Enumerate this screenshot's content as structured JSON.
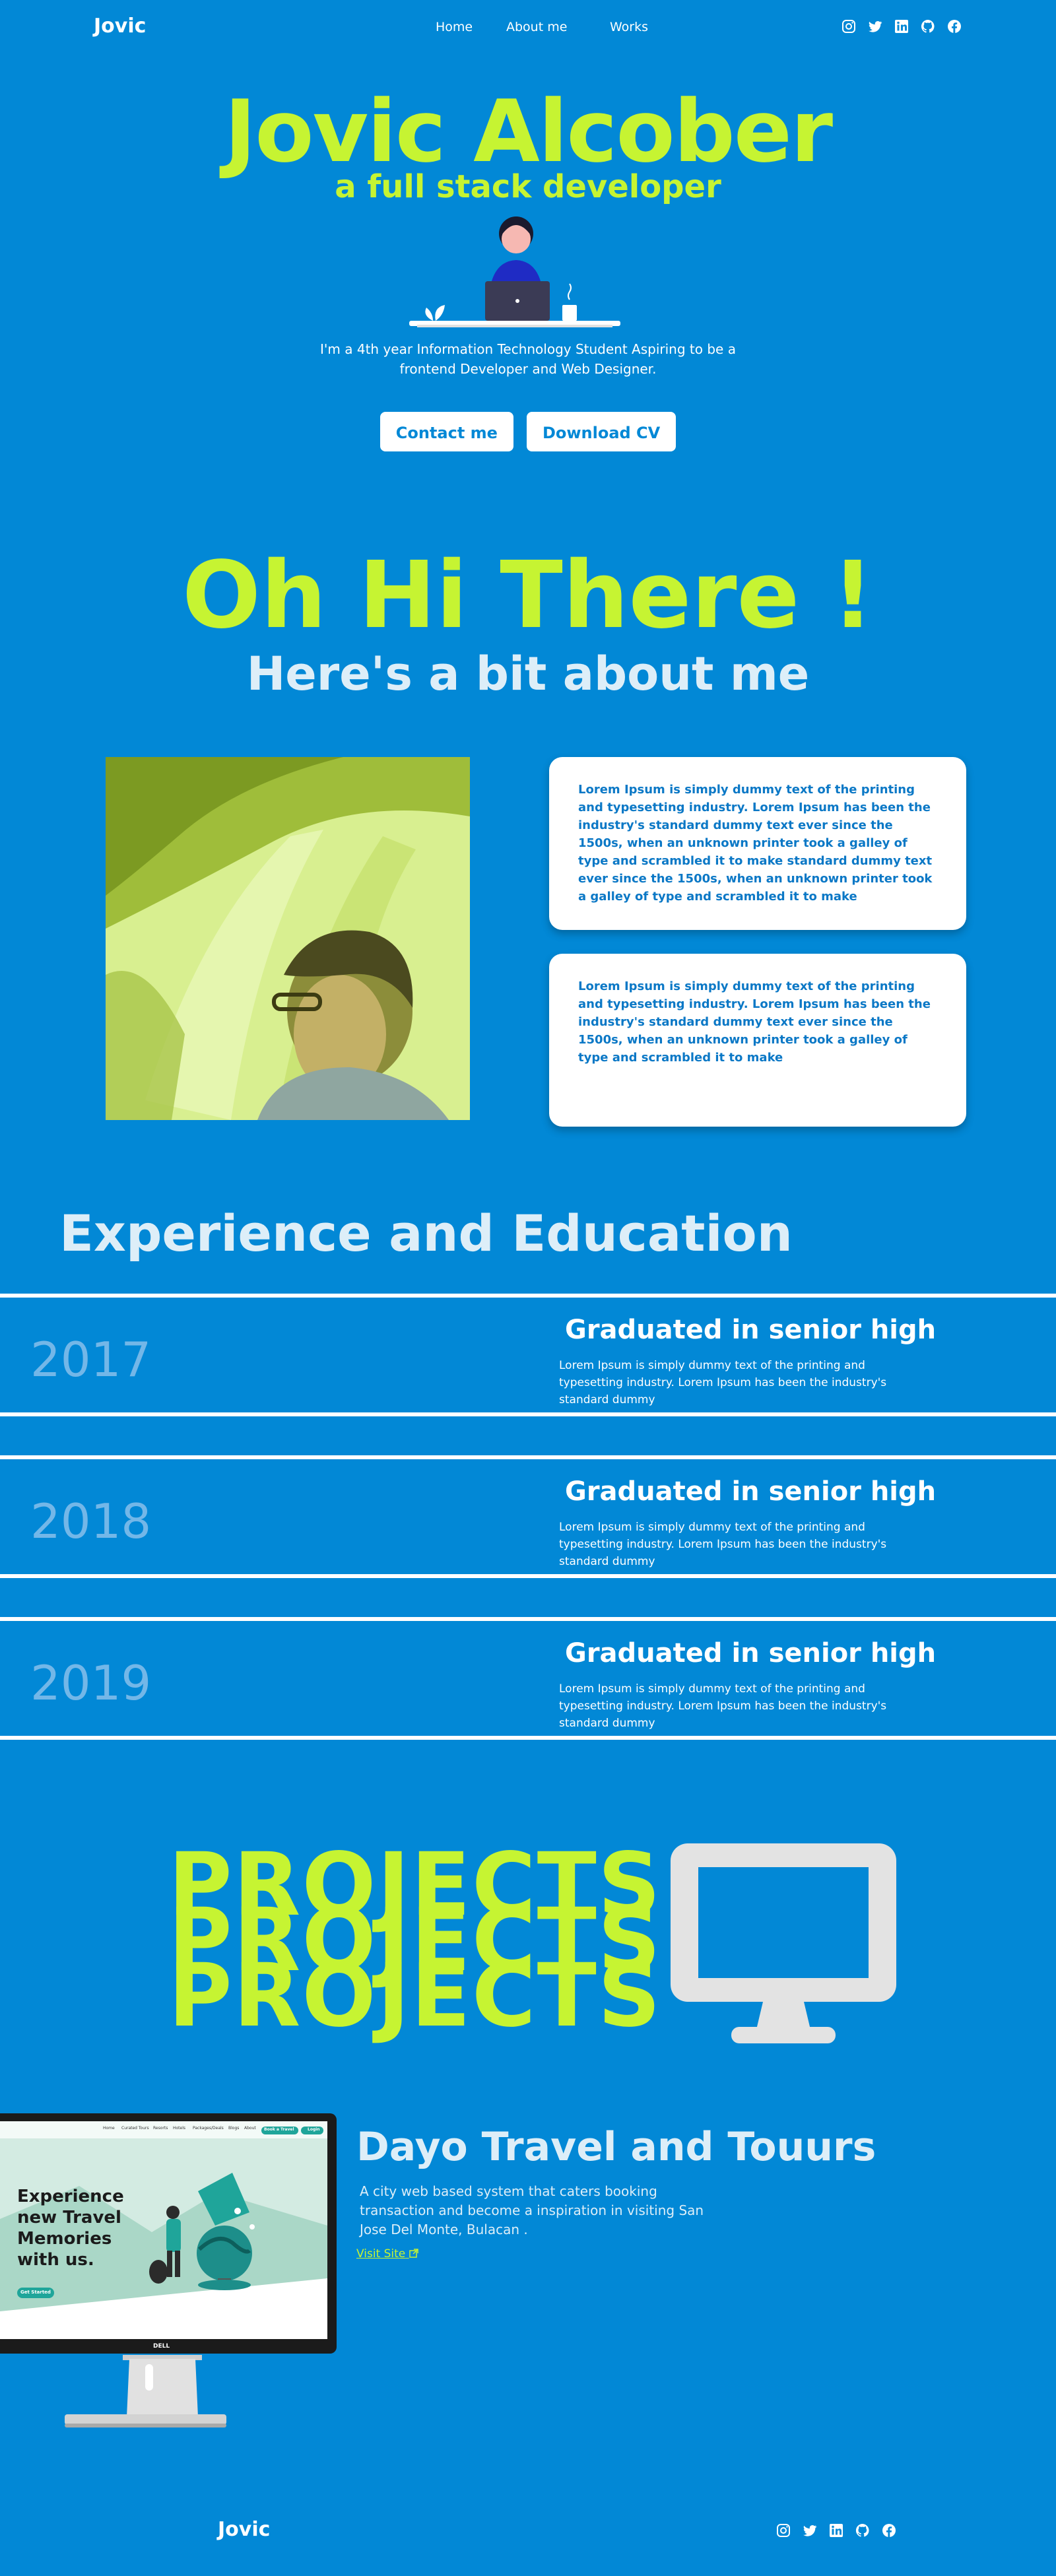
{
  "nav": {
    "logo": "Jovic",
    "links": [
      "Home",
      "About me",
      "Works"
    ]
  },
  "socials": [
    "instagram-icon",
    "twitter-icon",
    "linkedin-icon",
    "github-icon",
    "facebook-icon"
  ],
  "hero": {
    "name": "Jovic Alcober",
    "role": "a full stack developer",
    "description": "I'm a 4th year Information Technology Student Aspiring to be a frontend Developer and Web Designer.",
    "buttons": [
      "Contact me",
      "Download CV"
    ]
  },
  "about": {
    "greeting": "Oh Hi There !",
    "subtitle": "Here's a bit about me",
    "card1": "Lorem Ipsum is simply dummy text of the printing and typesetting industry. Lorem Ipsum has been the industry's standard dummy text ever since the 1500s, when an unknown printer took a galley of type and scrambled it to make standard dummy text ever since the 1500s, when an unknown printer took a galley of type and scrambled it to make",
    "card2": "Lorem Ipsum is simply dummy text of the printing and typesetting industry. Lorem Ipsum has been the industry's standard dummy text ever since the 1500s, when an unknown printer took a galley of type and scrambled it to make"
  },
  "experience": {
    "title": "Experience and Education",
    "items": [
      {
        "year": "2017",
        "title": "Graduated in senior high",
        "desc": "Lorem Ipsum is simply dummy text of the printing and typesetting industry. Lorem Ipsum has been the industry's standard dummy"
      },
      {
        "year": "2018",
        "title": "Graduated in senior high",
        "desc": "Lorem Ipsum is simply dummy text of the printing and typesetting industry. Lorem Ipsum has been the industry's standard dummy"
      },
      {
        "year": "2019",
        "title": "Graduated in senior high",
        "desc": "Lorem Ipsum is simply dummy text of the printing and typesetting industry. Lorem Ipsum has been the industry's standard dummy"
      }
    ]
  },
  "projects": {
    "heading": "PROJECTS",
    "item": {
      "name": "Dayo Travel and Touurs",
      "desc": "A city web based system that caters booking transaction and become a inspiration in visiting San Jose Del Monte, Bulacan .",
      "link": "Visit Site",
      "screen_headline": "Experience new Travel Memories with us.",
      "screen_button": "Get Started",
      "screen_nav": [
        "Home",
        "Curated Tours",
        "Resorts",
        "Hotels",
        "Packages/Deals",
        "Blogs",
        "About"
      ],
      "screen_cta": [
        "Book a Travel",
        "Login"
      ],
      "brand": "DELL"
    }
  },
  "footer": {
    "logo": "Jovic"
  },
  "colors": {
    "background": "#0288d6",
    "accent": "#c6f432",
    "muted_text": "#ddeef8"
  }
}
